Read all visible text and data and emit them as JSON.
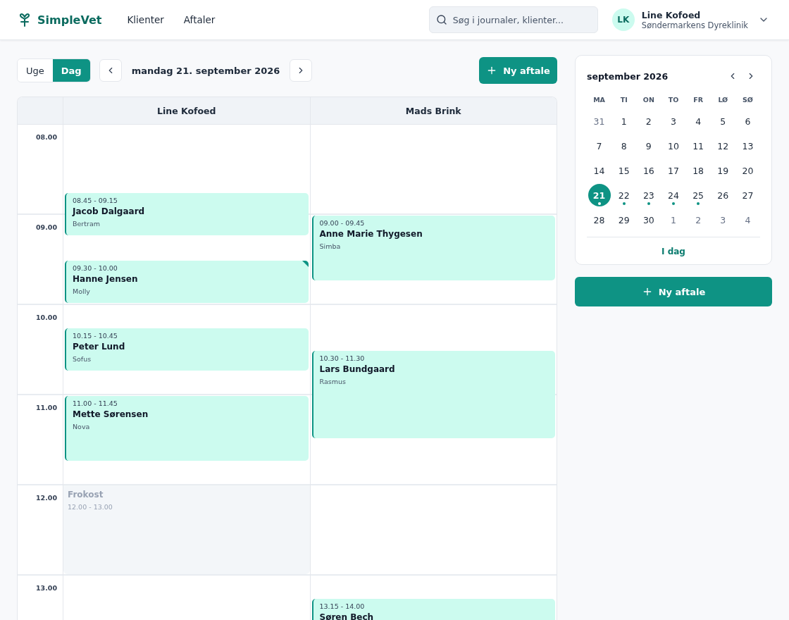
{
  "header": {
    "logo": "SimpleVet",
    "nav": [
      {
        "label": "Klienter",
        "selected": false
      },
      {
        "label": "Aftaler",
        "selected": false
      }
    ],
    "search": {
      "placeholder": "Søg i journaler, klienter..."
    },
    "user": {
      "initials": "LK",
      "name": "Line Kofoed",
      "clinic": "Søndermarkens Dyreklinik"
    }
  },
  "toolbar": {
    "views": [
      {
        "label": "Uge",
        "selected": false
      },
      {
        "label": "Dag",
        "selected": true
      }
    ],
    "date": "mandag 21. september 2026",
    "new_button": "Ny aftale"
  },
  "schedule": {
    "hours": [
      "08.00",
      "09.00",
      "10.00",
      "11.00",
      "12.00",
      "13.00"
    ],
    "columns": [
      {
        "name": "Line Kofoed",
        "items": [
          {
            "kind": "appointment",
            "time": "08.45 - 09.15",
            "client": "Jacob Dalgaard",
            "patient": "Bertram",
            "flagged": false
          },
          {
            "kind": "appointment",
            "time": "09.30 - 10.00",
            "client": "Hanne Jensen",
            "patient": "Molly",
            "flagged": true
          },
          {
            "kind": "appointment",
            "time": "10.15 - 10.45",
            "client": "Peter Lund",
            "patient": "Sofus",
            "flagged": false
          },
          {
            "kind": "appointment",
            "time": "11.00 - 11.45",
            "client": "Mette Sørensen",
            "patient": "Nova",
            "flagged": false
          },
          {
            "kind": "break",
            "title": "Frokost",
            "time": "12.00 - 13.00"
          }
        ]
      },
      {
        "name": "Mads Brink",
        "items": [
          {
            "kind": "appointment",
            "time": "09.00 - 09.45",
            "client": "Anne Marie Thygesen",
            "patient": "Simba",
            "flagged": false
          },
          {
            "kind": "appointment",
            "time": "10.30 - 11.30",
            "client": "Lars Bundgaard",
            "patient": "Rasmus",
            "flagged": false
          },
          {
            "kind": "appointment",
            "time": "13.15 - 14.00",
            "client": "Søren Bech",
            "flagged": false
          }
        ]
      }
    ]
  },
  "calendar": {
    "month": "september 2026",
    "weekdays": [
      "MA",
      "TI",
      "ON",
      "TO",
      "FR",
      "LØ",
      "SØ"
    ],
    "weeks": [
      [
        {
          "day": "31",
          "muted": true,
          "selected": false,
          "has_appointments": false
        },
        {
          "day": "1",
          "muted": false,
          "selected": false,
          "has_appointments": false
        },
        {
          "day": "2",
          "muted": false,
          "selected": false,
          "has_appointments": false
        },
        {
          "day": "3",
          "muted": false,
          "selected": false,
          "has_appointments": false
        },
        {
          "day": "4",
          "muted": false,
          "selected": false,
          "has_appointments": false
        },
        {
          "day": "5",
          "muted": false,
          "selected": false,
          "has_appointments": false
        },
        {
          "day": "6",
          "muted": false,
          "selected": false,
          "has_appointments": false
        }
      ],
      [
        {
          "day": "7",
          "muted": false,
          "selected": false,
          "has_appointments": false
        },
        {
          "day": "8",
          "muted": false,
          "selected": false,
          "has_appointments": false
        },
        {
          "day": "9",
          "muted": false,
          "selected": false,
          "has_appointments": false
        },
        {
          "day": "10",
          "muted": false,
          "selected": false,
          "has_appointments": false
        },
        {
          "day": "11",
          "muted": false,
          "selected": false,
          "has_appointments": false
        },
        {
          "day": "12",
          "muted": false,
          "selected": false,
          "has_appointments": false
        },
        {
          "day": "13",
          "muted": false,
          "selected": false,
          "has_appointments": false
        }
      ],
      [
        {
          "day": "14",
          "muted": false,
          "selected": false,
          "has_appointments": false
        },
        {
          "day": "15",
          "muted": false,
          "selected": false,
          "has_appointments": false
        },
        {
          "day": "16",
          "muted": false,
          "selected": false,
          "has_appointments": false
        },
        {
          "day": "17",
          "muted": false,
          "selected": false,
          "has_appointments": false
        },
        {
          "day": "18",
          "muted": false,
          "selected": false,
          "has_appointments": false
        },
        {
          "day": "19",
          "muted": false,
          "selected": false,
          "has_appointments": false
        },
        {
          "day": "20",
          "muted": false,
          "selected": false,
          "has_appointments": false
        }
      ],
      [
        {
          "day": "21",
          "muted": false,
          "selected": true,
          "has_appointments": true
        },
        {
          "day": "22",
          "muted": false,
          "selected": false,
          "has_appointments": true
        },
        {
          "day": "23",
          "muted": false,
          "selected": false,
          "has_appointments": true
        },
        {
          "day": "24",
          "muted": false,
          "selected": false,
          "has_appointments": true
        },
        {
          "day": "25",
          "muted": false,
          "selected": false,
          "has_appointments": true
        },
        {
          "day": "26",
          "muted": false,
          "selected": false,
          "has_appointments": false
        },
        {
          "day": "27",
          "muted": false,
          "selected": false,
          "has_appointments": false
        }
      ],
      [
        {
          "day": "28",
          "muted": false,
          "selected": false,
          "has_appointments": false
        },
        {
          "day": "29",
          "muted": false,
          "selected": false,
          "has_appointments": false
        },
        {
          "day": "30",
          "muted": false,
          "selected": false,
          "has_appointments": false
        },
        {
          "day": "1",
          "muted": true,
          "selected": false,
          "has_appointments": false
        },
        {
          "day": "2",
          "muted": true,
          "selected": false,
          "has_appointments": false
        },
        {
          "day": "3",
          "muted": true,
          "selected": false,
          "has_appointments": false
        },
        {
          "day": "4",
          "muted": true,
          "selected": false,
          "has_appointments": false
        }
      ]
    ],
    "today_link": "I dag"
  },
  "side_button": "Ny aftale"
}
